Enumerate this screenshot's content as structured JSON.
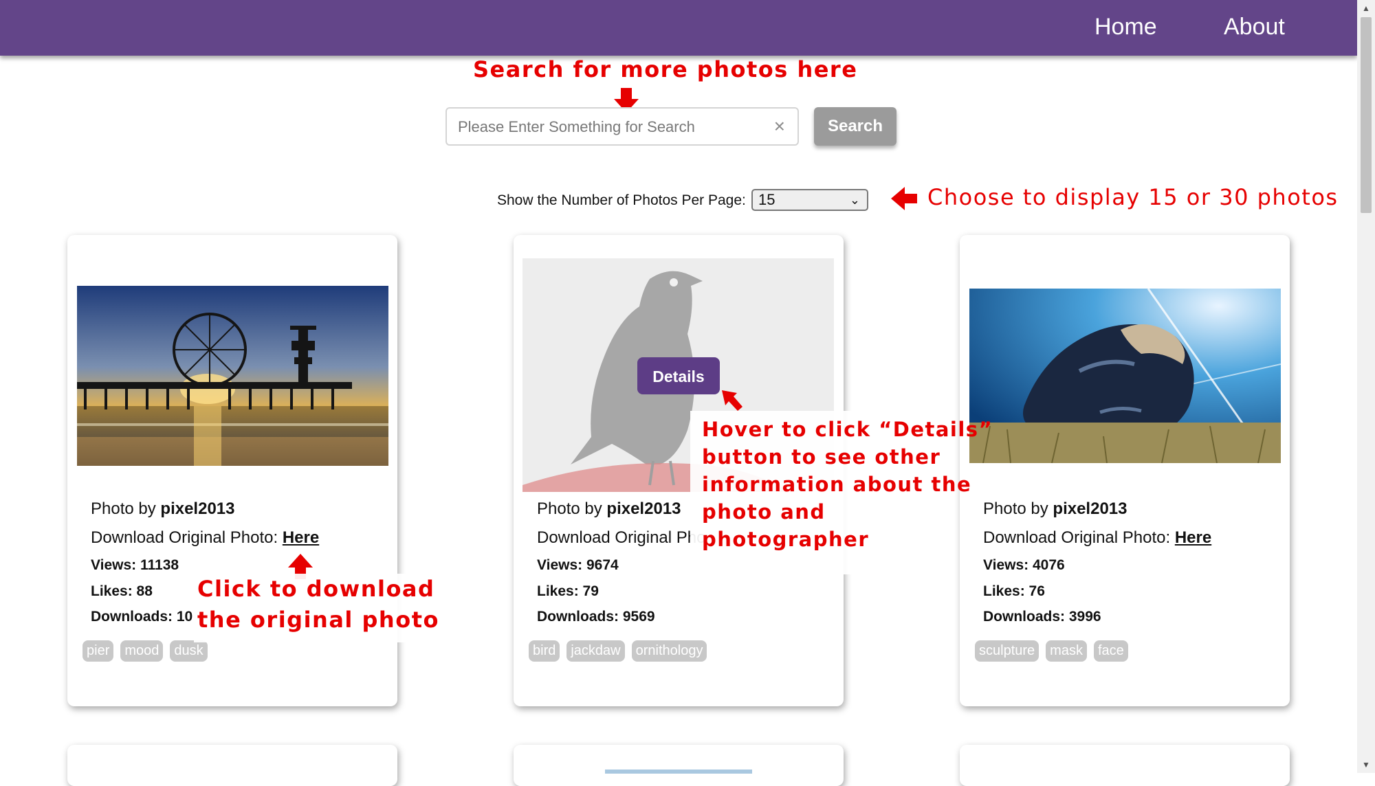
{
  "nav": {
    "home": "Home",
    "about": "About"
  },
  "search": {
    "placeholder": "Please Enter Something for Search",
    "clear_icon": "×",
    "button": "Search"
  },
  "per_page": {
    "label": "Show the Number of Photos Per Page:",
    "value": "15"
  },
  "annotations": {
    "search": "Search for more photos here",
    "per_page": "Choose to display 15 or 30 photos",
    "download_line1": "Click to download",
    "download_line2": "the original photo",
    "details_lines": [
      "Hover to click “Details”",
      "button to see other",
      "information about the",
      "photo and",
      "photographer"
    ]
  },
  "photos": [
    {
      "photographer_prefix": "Photo by ",
      "photographer": "pixel2013",
      "download_label": "Download Original Photo: ",
      "download_link": "Here",
      "views": "Views: 11138",
      "likes": "Likes: 88",
      "downloads": "Downloads: 10",
      "tags": [
        "pier",
        "mood",
        "dusk"
      ],
      "image": "pier-ferris-wheel-sunset"
    },
    {
      "photographer_prefix": "Photo by ",
      "photographer": "pixel2013",
      "download_label": "Download Original Pho",
      "download_link": "",
      "views": "Views: 9674",
      "likes": "Likes: 79",
      "downloads": "Downloads: 9569",
      "tags": [
        "bird",
        "jackdaw",
        "ornithology"
      ],
      "image": "jackdaw-bird",
      "details_button": "Details"
    },
    {
      "photographer_prefix": "Photo by ",
      "photographer": "pixel2013",
      "download_label": "Download Original Photo: ",
      "download_link": "Here",
      "views": "Views: 4076",
      "likes": "Likes: 76",
      "downloads": "Downloads: 3996",
      "tags": [
        "sculpture",
        "mask",
        "face"
      ],
      "image": "stone-face-sculpture"
    }
  ],
  "colors": {
    "navbar": "#634589",
    "annotation": "#e60000",
    "details_button": "#5d3d86",
    "tag_bg": "#c8c8c8"
  }
}
